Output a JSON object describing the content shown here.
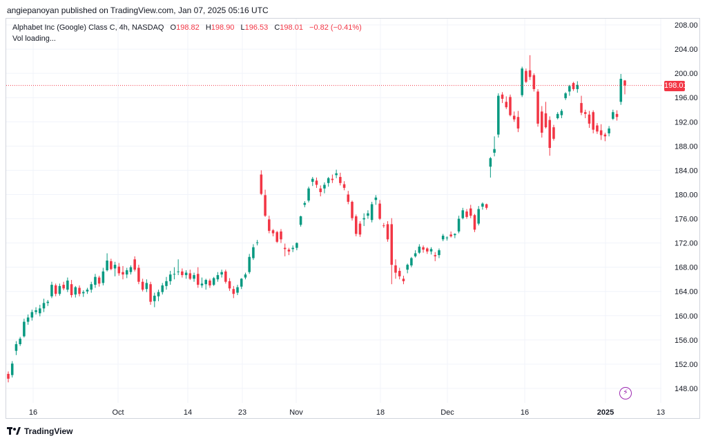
{
  "header": {
    "published_by": "angiepanoyan published on TradingView.com, Jan 07, 2025 05:16 UTC"
  },
  "legend": {
    "symbol": "Alphabet Inc (Google) Class C, 4h, NASDAQ",
    "o_label": "O",
    "o_value": "198.82",
    "h_label": "H",
    "h_value": "198.90",
    "l_label": "L",
    "l_value": "196.53",
    "c_label": "C",
    "c_value": "198.01",
    "change": "−0.82 (−0.41%)",
    "vol_text": "Vol loading..."
  },
  "last_price_label": "198.01",
  "footer": {
    "brand": "TradingView"
  },
  "colors": {
    "up": "#089981",
    "down": "#f23645",
    "grid": "#f0f3fa",
    "axis_text": "#131722",
    "accent": "#9c27b0"
  },
  "chart_data": {
    "type": "candlestick",
    "title": "Alphabet Inc (Google) Class C, 4h, NASDAQ",
    "y_ticks": [
      "148.00",
      "152.00",
      "156.00",
      "160.00",
      "164.00",
      "168.00",
      "172.00",
      "176.00",
      "180.00",
      "184.00",
      "188.00",
      "192.00",
      "196.00",
      "200.00",
      "204.00",
      "208.00"
    ],
    "ylim": [
      146,
      210
    ],
    "x_ticks": [
      "16",
      "Oct",
      "14",
      "23",
      "Nov",
      "18",
      "Dec",
      "16",
      "2025",
      "13"
    ],
    "last_price": 198.01,
    "grid": true,
    "candles": [
      [
        150.4,
        150.8,
        149.0,
        149.6
      ],
      [
        150.2,
        152.5,
        149.8,
        152.1
      ],
      [
        154.2,
        155.8,
        153.5,
        155.3
      ],
      [
        155.3,
        156.5,
        155.0,
        156.2
      ],
      [
        156.6,
        159.5,
        156.4,
        159.0
      ],
      [
        159.0,
        160.2,
        158.5,
        159.7
      ],
      [
        159.7,
        161.0,
        159.2,
        160.6
      ],
      [
        160.6,
        161.4,
        160.2,
        160.9
      ],
      [
        160.4,
        161.8,
        159.9,
        161.2
      ],
      [
        161.2,
        162.8,
        160.6,
        162.1
      ],
      [
        162.1,
        162.6,
        161.6,
        162.3
      ],
      [
        163.2,
        165.6,
        162.9,
        165.1
      ],
      [
        165.0,
        165.3,
        163.2,
        163.6
      ],
      [
        163.6,
        165.3,
        163.3,
        164.9
      ],
      [
        165.1,
        165.6,
        164.2,
        164.5
      ],
      [
        164.3,
        166.3,
        163.9,
        165.8
      ],
      [
        165.2,
        165.9,
        163.0,
        163.4
      ],
      [
        163.5,
        164.9,
        163.0,
        164.7
      ],
      [
        164.6,
        165.0,
        163.2,
        163.6
      ],
      [
        163.7,
        164.2,
        163.1,
        163.9
      ],
      [
        164.0,
        164.6,
        163.6,
        164.3
      ],
      [
        164.3,
        165.6,
        163.8,
        165.2
      ],
      [
        165.1,
        166.9,
        164.6,
        166.4
      ],
      [
        166.3,
        166.6,
        164.8,
        165.3
      ],
      [
        165.4,
        167.9,
        165.0,
        167.3
      ],
      [
        167.5,
        170.3,
        167.3,
        169.1
      ],
      [
        169.0,
        169.4,
        167.5,
        167.7
      ],
      [
        167.8,
        168.9,
        166.5,
        168.4
      ],
      [
        168.1,
        168.7,
        166.6,
        167.0
      ],
      [
        167.2,
        168.2,
        166.0,
        166.8
      ],
      [
        166.8,
        167.9,
        166.2,
        167.5
      ],
      [
        167.2,
        168.3,
        166.8,
        168.0
      ],
      [
        169.3,
        169.8,
        167.3,
        167.6
      ],
      [
        167.9,
        168.4,
        165.2,
        165.6
      ],
      [
        165.6,
        166.1,
        164.0,
        164.3
      ],
      [
        164.4,
        166.0,
        163.9,
        165.4
      ],
      [
        165.2,
        165.6,
        161.8,
        162.3
      ],
      [
        162.4,
        163.8,
        161.4,
        163.3
      ],
      [
        163.2,
        164.3,
        162.4,
        163.9
      ],
      [
        163.9,
        165.4,
        163.5,
        165.0
      ],
      [
        164.9,
        166.4,
        164.3,
        165.7
      ],
      [
        165.7,
        167.4,
        165.1,
        166.8
      ],
      [
        166.8,
        168.0,
        166.0,
        166.9
      ],
      [
        167.2,
        169.3,
        166.7,
        167.3
      ],
      [
        167.3,
        167.8,
        166.3,
        166.7
      ],
      [
        166.7,
        167.5,
        166.1,
        167.1
      ],
      [
        167.0,
        167.6,
        165.9,
        166.1
      ],
      [
        166.1,
        167.1,
        165.6,
        166.7
      ],
      [
        166.9,
        168.0,
        164.6,
        165.1
      ],
      [
        165.0,
        166.3,
        164.6,
        165.3
      ],
      [
        165.2,
        166.1,
        164.3,
        165.9
      ],
      [
        165.8,
        166.1,
        164.6,
        165.0
      ],
      [
        165.1,
        166.4,
        164.9,
        166.2
      ],
      [
        166.0,
        167.2,
        165.6,
        166.7
      ],
      [
        166.8,
        167.6,
        166.3,
        167.2
      ],
      [
        167.3,
        167.6,
        165.3,
        165.6
      ],
      [
        165.7,
        166.2,
        164.1,
        164.5
      ],
      [
        164.4,
        164.9,
        162.9,
        163.6
      ],
      [
        163.8,
        165.1,
        163.4,
        164.7
      ],
      [
        164.8,
        166.2,
        164.4,
        166.1
      ],
      [
        166.3,
        167.1,
        166.0,
        166.8
      ],
      [
        167.2,
        170.2,
        166.9,
        169.7
      ],
      [
        169.5,
        171.8,
        169.2,
        171.3
      ],
      [
        172.0,
        172.5,
        171.6,
        172.1
      ],
      [
        183.3,
        184.0,
        179.9,
        180.1
      ],
      [
        179.9,
        180.8,
        176.3,
        176.5
      ],
      [
        175.9,
        176.5,
        173.6,
        174.0
      ],
      [
        174.1,
        174.3,
        173.1,
        173.6
      ],
      [
        173.8,
        174.0,
        172.0,
        172.2
      ],
      [
        173.9,
        174.3,
        172.0,
        172.6
      ],
      [
        171.2,
        171.9,
        169.8,
        171.0
      ],
      [
        170.9,
        171.2,
        170.0,
        170.6
      ],
      [
        171.0,
        171.6,
        170.5,
        171.2
      ],
      [
        171.2,
        172.1,
        170.8,
        172.0
      ],
      [
        175.0,
        176.5,
        174.7,
        176.4
      ],
      [
        178.3,
        178.9,
        177.9,
        178.6
      ],
      [
        179.0,
        181.3,
        178.7,
        181.0
      ],
      [
        182.1,
        182.9,
        181.4,
        182.6
      ],
      [
        182.3,
        182.8,
        181.1,
        181.6
      ],
      [
        181.0,
        181.5,
        179.7,
        180.4
      ],
      [
        181.0,
        182.0,
        180.2,
        181.6
      ],
      [
        181.9,
        182.9,
        181.3,
        182.7
      ],
      [
        182.6,
        183.3,
        181.9,
        182.4
      ],
      [
        183.2,
        184.1,
        182.7,
        183.5
      ],
      [
        182.9,
        183.6,
        181.5,
        181.9
      ],
      [
        181.7,
        182.2,
        180.7,
        181.1
      ],
      [
        180.0,
        180.6,
        178.4,
        178.8
      ],
      [
        178.8,
        179.0,
        175.7,
        176.1
      ],
      [
        176.4,
        176.7,
        173.1,
        173.5
      ],
      [
        175.2,
        175.6,
        173.0,
        173.4
      ],
      [
        175.9,
        176.9,
        174.8,
        176.1
      ],
      [
        176.5,
        177.4,
        176.0,
        176.9
      ],
      [
        175.8,
        178.8,
        175.4,
        178.4
      ],
      [
        179.1,
        179.9,
        178.3,
        179.5
      ],
      [
        178.5,
        179.1,
        175.8,
        176.0
      ],
      [
        174.9,
        175.3,
        174.5,
        174.8
      ],
      [
        175.1,
        175.6,
        172.2,
        172.6
      ],
      [
        175.1,
        176.1,
        165.2,
        168.4
      ],
      [
        168.3,
        169.3,
        166.1,
        167.1
      ],
      [
        167.4,
        167.9,
        166.0,
        166.5
      ],
      [
        166.1,
        166.6,
        165.2,
        165.7
      ],
      [
        167.6,
        168.6,
        167.0,
        168.4
      ],
      [
        168.3,
        169.7,
        168.0,
        169.5
      ],
      [
        169.8,
        170.8,
        169.6,
        170.3
      ],
      [
        170.4,
        171.8,
        170.2,
        171.4
      ],
      [
        171.3,
        171.6,
        170.4,
        170.9
      ],
      [
        171.1,
        171.3,
        170.2,
        170.6
      ],
      [
        170.6,
        171.3,
        170.1,
        171.0
      ],
      [
        170.0,
        170.5,
        169.0,
        169.8
      ],
      [
        170.0,
        171.1,
        169.5,
        170.8
      ],
      [
        172.6,
        173.5,
        172.3,
        173.2
      ],
      [
        172.8,
        173.1,
        172.4,
        172.9
      ],
      [
        173.4,
        173.9,
        172.9,
        173.1
      ],
      [
        173.3,
        173.6,
        172.8,
        173.5
      ],
      [
        173.9,
        176.5,
        173.6,
        176.0
      ],
      [
        176.1,
        177.8,
        175.9,
        177.4
      ],
      [
        177.2,
        177.6,
        176.0,
        176.3
      ],
      [
        177.7,
        178.3,
        176.1,
        176.5
      ],
      [
        176.6,
        176.8,
        173.8,
        174.2
      ],
      [
        175.2,
        178.1,
        174.9,
        177.6
      ],
      [
        178.0,
        178.7,
        177.5,
        178.5
      ],
      [
        178.4,
        178.5,
        177.5,
        177.8
      ],
      [
        184.6,
        186.2,
        182.8,
        186.0
      ],
      [
        186.9,
        189.6,
        186.3,
        187.5
      ],
      [
        189.9,
        196.7,
        189.4,
        196.3
      ],
      [
        196.5,
        196.9,
        195.1,
        195.8
      ],
      [
        195.3,
        196.2,
        194.1,
        194.4
      ],
      [
        196.1,
        196.5,
        192.9,
        193.1
      ],
      [
        193.0,
        193.7,
        192.0,
        192.4
      ],
      [
        192.8,
        193.8,
        190.3,
        190.9
      ],
      [
        196.4,
        201.1,
        196.1,
        200.8
      ],
      [
        200.4,
        200.8,
        198.4,
        198.6
      ],
      [
        200.5,
        203.0,
        198.9,
        199.4
      ],
      [
        199.7,
        200.0,
        197.0,
        197.4
      ],
      [
        197.0,
        197.4,
        191.2,
        191.7
      ],
      [
        193.7,
        194.6,
        189.4,
        190.2
      ],
      [
        193.4,
        195.3,
        190.9,
        191.1
      ],
      [
        192.3,
        192.9,
        186.4,
        187.7
      ],
      [
        191.1,
        191.5,
        188.9,
        189.2
      ],
      [
        192.6,
        193.6,
        192.4,
        193.3
      ],
      [
        193.1,
        194.1,
        192.6,
        193.8
      ],
      [
        195.9,
        196.9,
        195.6,
        196.7
      ],
      [
        197.0,
        198.1,
        196.3,
        197.9
      ],
      [
        198.4,
        198.6,
        197.1,
        197.4
      ],
      [
        197.4,
        198.7,
        196.8,
        198.1
      ],
      [
        195.1,
        196.3,
        193.1,
        193.5
      ],
      [
        193.6,
        194.0,
        192.6,
        193.3
      ],
      [
        193.2,
        193.8,
        191.0,
        191.7
      ],
      [
        193.6,
        193.9,
        190.1,
        190.7
      ],
      [
        191.4,
        191.8,
        190.0,
        190.4
      ],
      [
        190.6,
        191.6,
        189.0,
        189.8
      ],
      [
        189.9,
        190.2,
        188.8,
        189.6
      ],
      [
        190.1,
        191.3,
        189.6,
        190.9
      ],
      [
        192.5,
        194.0,
        192.3,
        193.6
      ],
      [
        193.3,
        193.9,
        192.2,
        192.8
      ],
      [
        195.3,
        199.9,
        194.8,
        199.1
      ],
      [
        198.82,
        198.9,
        196.53,
        198.01
      ]
    ]
  }
}
